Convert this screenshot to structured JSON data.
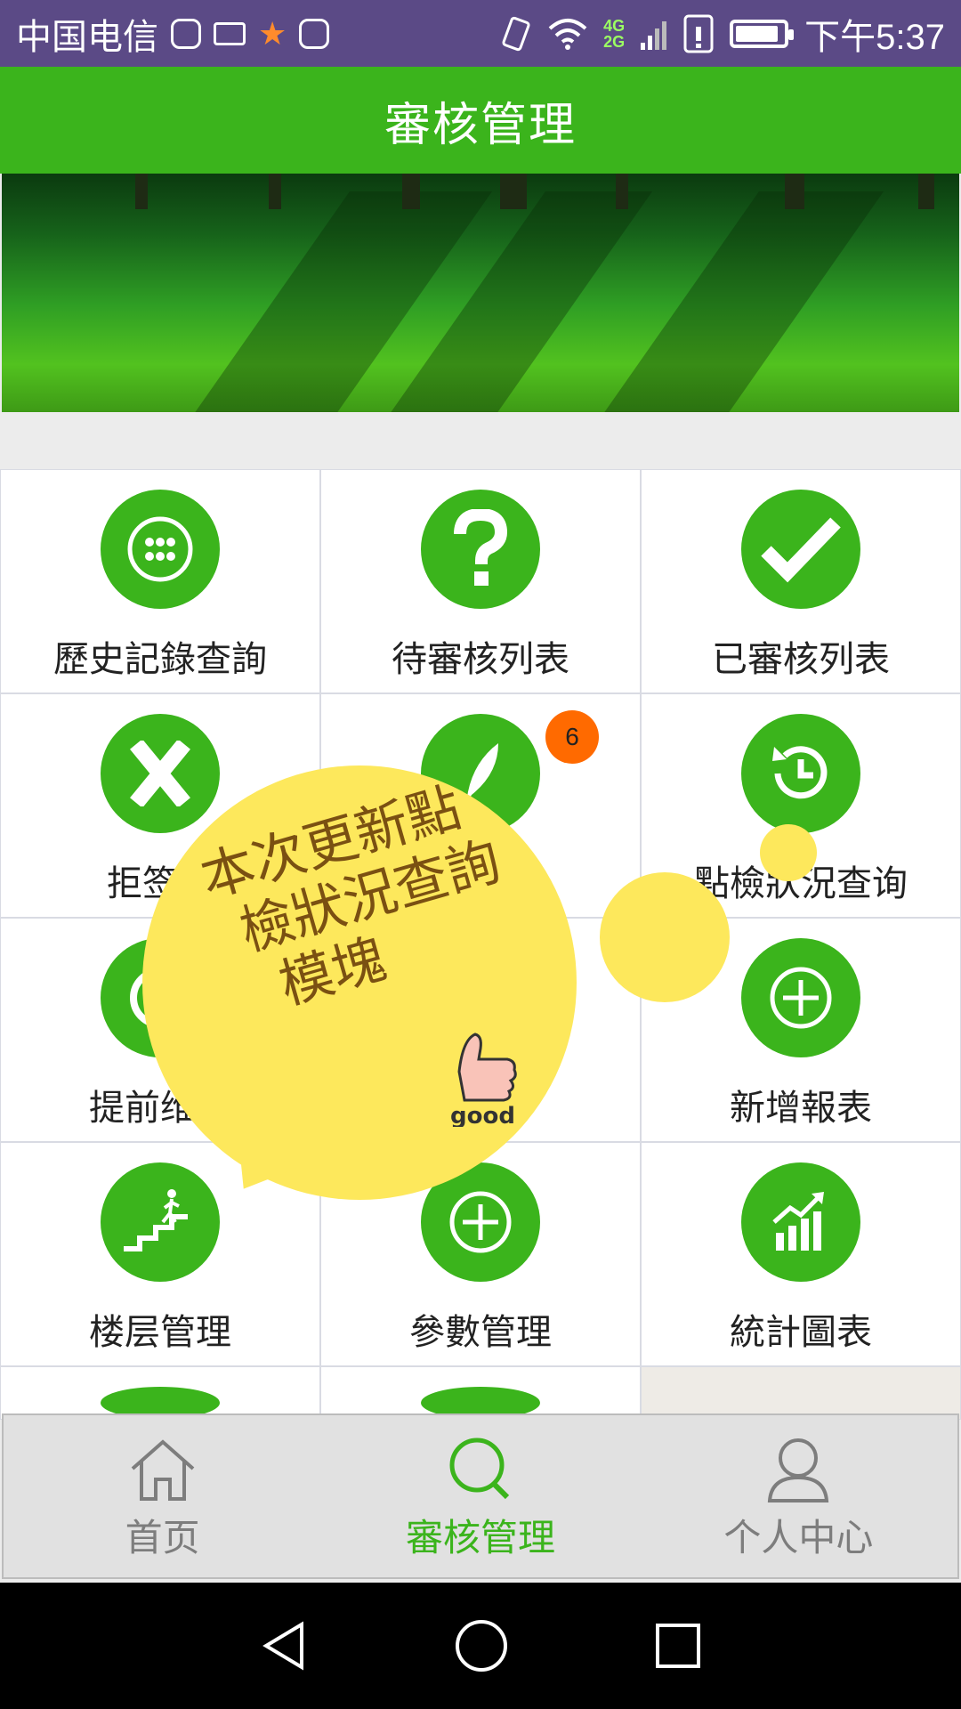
{
  "status_bar": {
    "carrier": "中国电信",
    "net_4g": "4G",
    "net_2g": "2G",
    "time": "下午5:37",
    "battery_level": 0.9
  },
  "header": {
    "title": "審核管理"
  },
  "grid": {
    "items": [
      {
        "label": "歷史記錄查詢",
        "icon": "dots-grid-icon"
      },
      {
        "label": "待審核列表",
        "icon": "question-icon"
      },
      {
        "label": "已審核列表",
        "icon": "check-icon"
      },
      {
        "label": "拒签列表",
        "icon": "x-icon",
        "visible_label": "拒签列"
      },
      {
        "label": "",
        "icon": "feather-icon",
        "badge": "6"
      },
      {
        "label": "點檢狀況查询",
        "icon": "history-icon"
      },
      {
        "label": "提前维护",
        "icon": "circle-icon",
        "visible_label": "提前维扩"
      },
      {
        "label": "",
        "icon": "plus-icon"
      },
      {
        "label": "新增報表",
        "icon": "plus-icon"
      },
      {
        "label": "楼层管理",
        "icon": "stairs-icon"
      },
      {
        "label": "參數管理",
        "icon": "plus-icon"
      },
      {
        "label": "統計圖表",
        "icon": "chart-icon"
      }
    ],
    "partial_labels": [
      "",
      ""
    ]
  },
  "popup": {
    "message": "本次更新點檢狀況查詢模塊",
    "line1": "本次更新點",
    "line2": "檢狀況查詢",
    "line3": "模塊",
    "thumb_text": "good",
    "color": "#fde85c"
  },
  "bottom_nav": {
    "items": [
      {
        "label": "首页",
        "icon": "home-icon"
      },
      {
        "label": "審核管理",
        "icon": "search-icon",
        "active": true
      },
      {
        "label": "个人中心",
        "icon": "person-icon"
      }
    ]
  },
  "colors": {
    "accent": "#3bb41c",
    "status_bar": "#5b4a86",
    "badge": "#ff6a00"
  }
}
